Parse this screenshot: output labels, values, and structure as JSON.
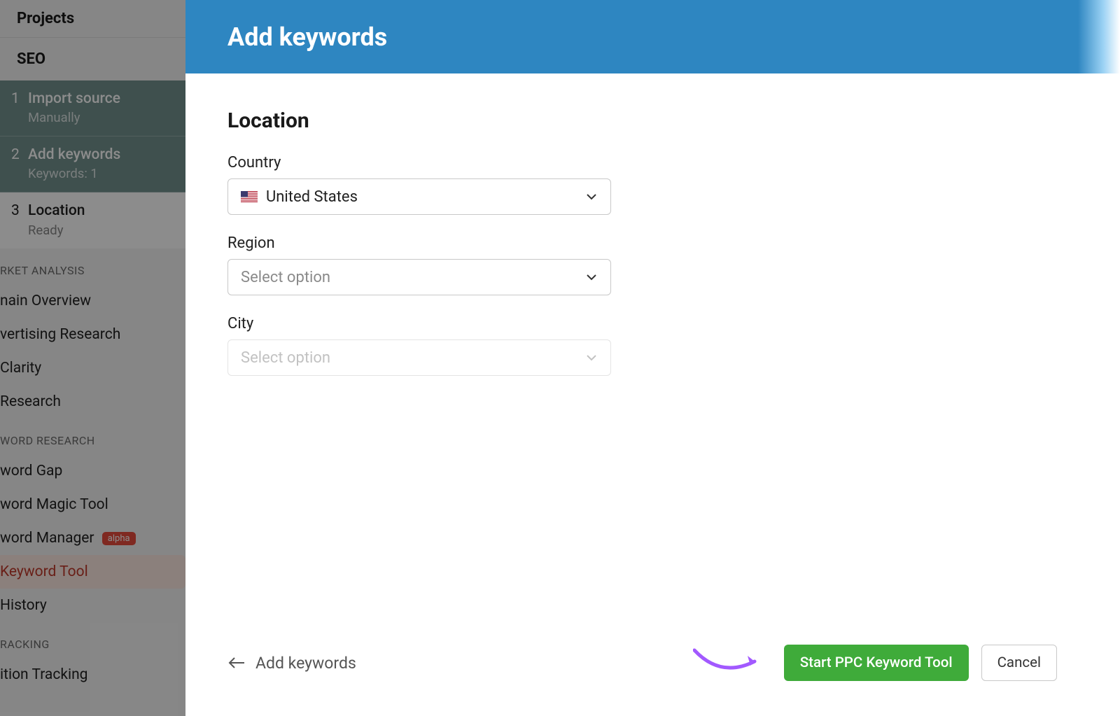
{
  "sidebar": {
    "projects_label": "Projects",
    "seo_label": "SEO",
    "steps": [
      {
        "num": "1",
        "title": "Import source",
        "sub": "Manually"
      },
      {
        "num": "2",
        "title": "Add keywords",
        "sub": "Keywords: 1"
      },
      {
        "num": "3",
        "title": "Location",
        "sub": "Ready"
      }
    ],
    "section_market": "RKET ANALYSIS",
    "market_items": [
      "nain Overview",
      "vertising Research",
      "Clarity",
      " Research"
    ],
    "section_keyword": "WORD RESEARCH",
    "keyword_items": [
      "word Gap",
      "word Magic Tool"
    ],
    "keyword_manager": "word Manager",
    "keyword_manager_badge": "alpha",
    "keyword_tool": " Keyword Tool",
    "keyword_history": " History",
    "section_tracking": "RACKING",
    "tracking_item": "ition Tracking"
  },
  "panel": {
    "header_title": "Add keywords",
    "section_title": "Location",
    "country_label": "Country",
    "country_value": "United States",
    "region_label": "Region",
    "region_placeholder": "Select option",
    "city_label": "City",
    "city_placeholder": "Select option",
    "back_label": "Add keywords",
    "primary_btn": "Start PPC Keyword Tool",
    "secondary_btn": "Cancel"
  }
}
